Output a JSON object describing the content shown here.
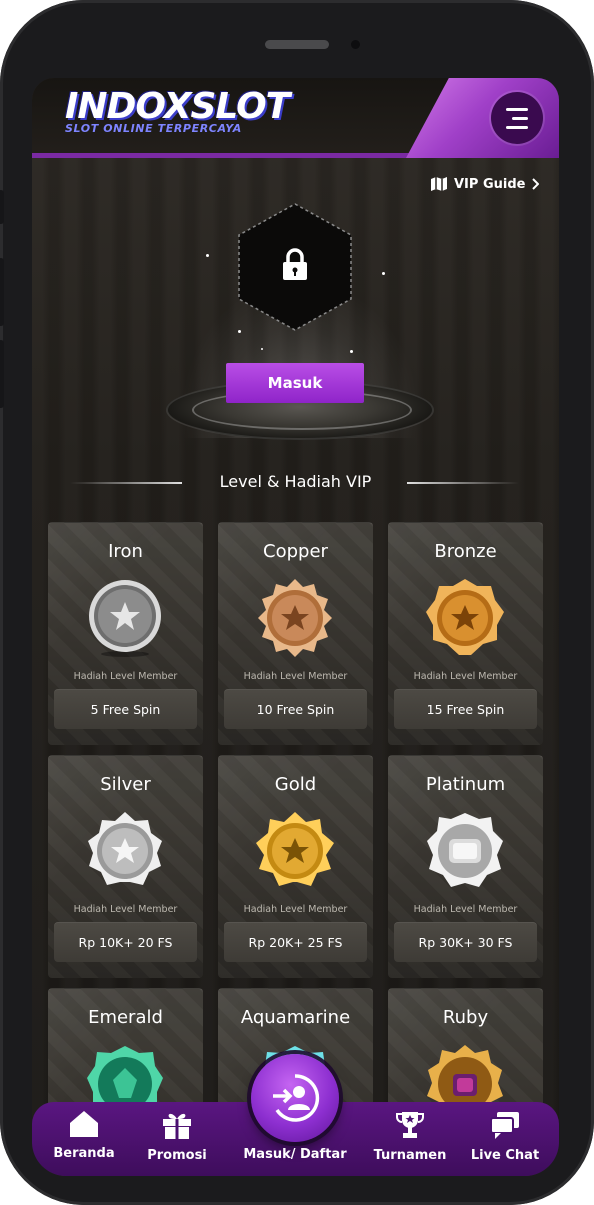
{
  "header": {
    "logo_main": "INDOXSLOT",
    "logo_sub": "SLOT ONLINE TERPERCAYA",
    "menu_icon": "hamburger-menu-icon"
  },
  "vip_guide": {
    "label": "VIP Guide",
    "icon": "map-icon"
  },
  "lock": {
    "icon": "lock-icon",
    "button_label": "Masuk"
  },
  "section": {
    "title": "Level & Hadiah VIP"
  },
  "levels": [
    {
      "name": "Iron",
      "reward_label": "Hadiah Level Member",
      "reward": "5 Free Spin",
      "color": "#9a9a9a"
    },
    {
      "name": "Copper",
      "reward_label": "Hadiah Level Member",
      "reward": "10 Free Spin",
      "color": "#c7884f"
    },
    {
      "name": "Bronze",
      "reward_label": "Hadiah Level Member",
      "reward": "15 Free Spin",
      "color": "#d28a2f"
    },
    {
      "name": "Silver",
      "reward_label": "Hadiah Level Member",
      "reward": "Rp 10K+ 20 FS",
      "color": "#c7c7c7"
    },
    {
      "name": "Gold",
      "reward_label": "Hadiah Level Member",
      "reward": "Rp 20K+ 25 FS",
      "color": "#e0a52a"
    },
    {
      "name": "Platinum",
      "reward_label": "Hadiah Level Member",
      "reward": "Rp 30K+ 30 FS",
      "color": "#d8d8d8"
    },
    {
      "name": "Emerald",
      "color": "#2fb58a"
    },
    {
      "name": "Aquamarine",
      "color": "#3fc1c9"
    },
    {
      "name": "Ruby",
      "color": "#d39a3a"
    }
  ],
  "nav": {
    "home": "Beranda",
    "promo": "Promosi",
    "login": "Masuk/ Daftar",
    "tournament": "Turnamen",
    "chat": "Live Chat"
  },
  "colors": {
    "accent": "#8f24c9",
    "nav_bg": "#4a1070",
    "card_bg": "#3a3732"
  }
}
